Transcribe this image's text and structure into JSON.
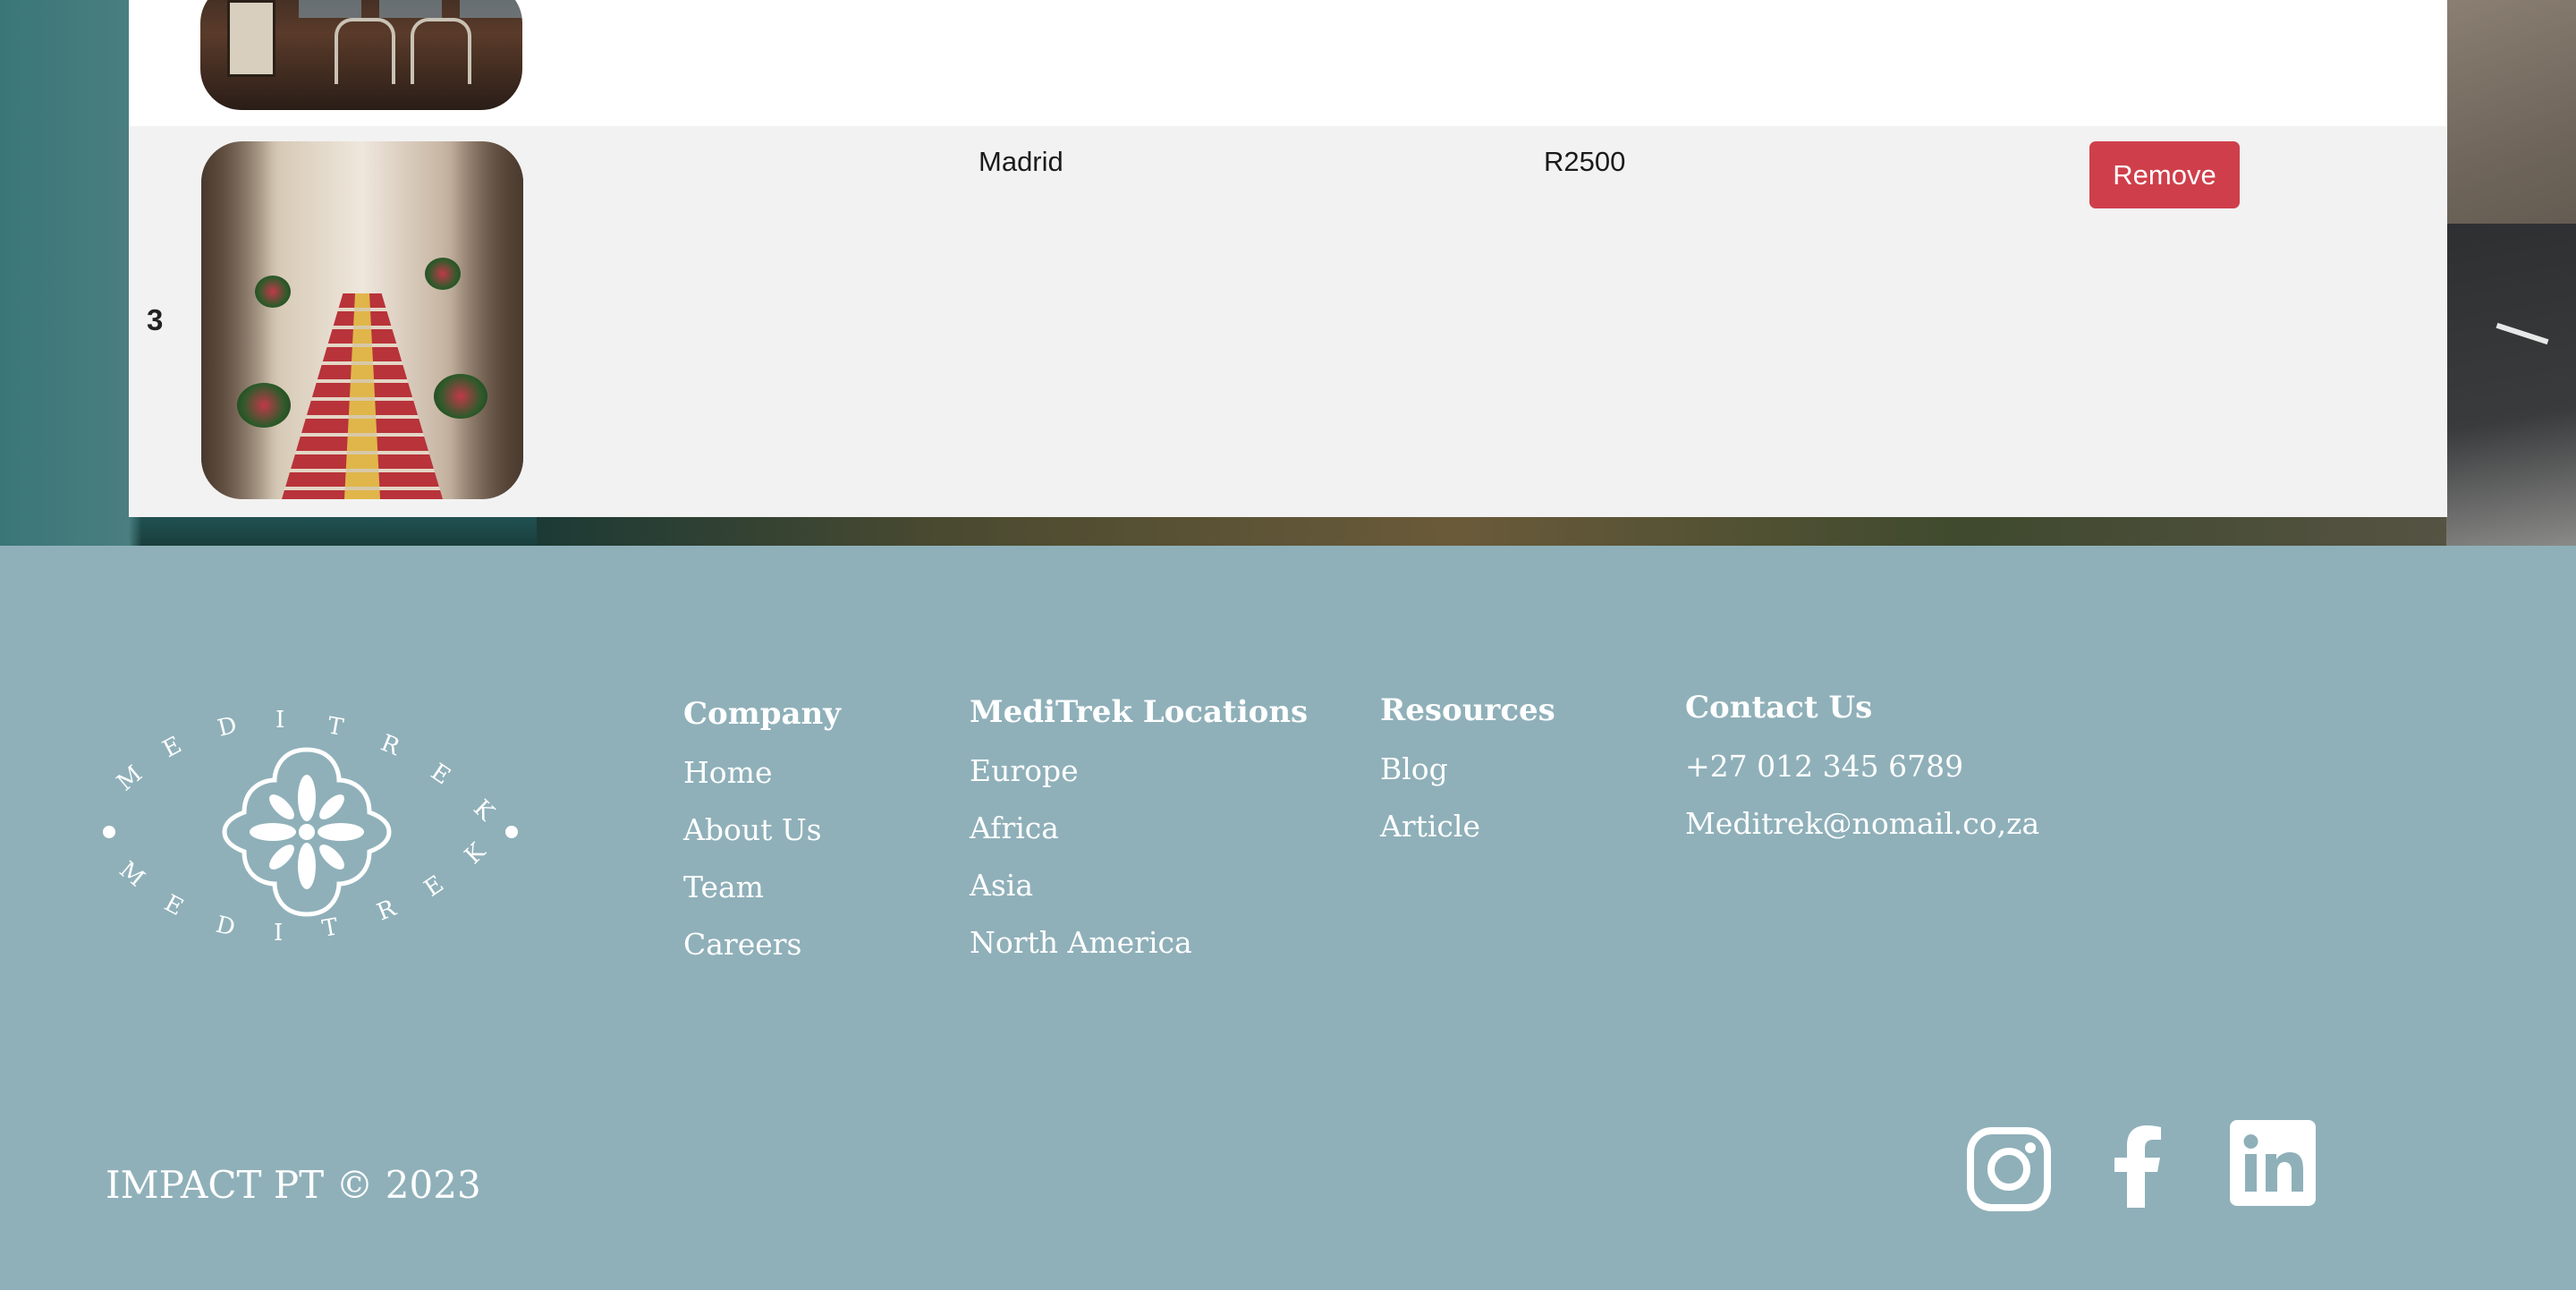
{
  "cart": {
    "rows": [
      {
        "index": "3",
        "destination": "Madrid",
        "price": "R2500",
        "remove_label": "Remove"
      }
    ]
  },
  "footer": {
    "logo_text": "MEDITREK",
    "columns": [
      {
        "title": "Company",
        "links": [
          "Home",
          "About Us",
          "Team",
          "Careers"
        ]
      },
      {
        "title": "MediTrek Locations",
        "links": [
          "Europe",
          "Africa",
          "Asia",
          "North America"
        ]
      },
      {
        "title": "Resources",
        "links": [
          "Blog",
          "Article"
        ]
      },
      {
        "title": "Contact Us",
        "links": [
          "+27 012 345 6789",
          "Meditrek@nomail.co,za"
        ]
      }
    ],
    "copyright": "IMPACT PT © 2023",
    "social": [
      {
        "icon": "instagram-icon"
      },
      {
        "icon": "facebook-icon"
      },
      {
        "icon": "linkedin-icon"
      }
    ]
  },
  "colors": {
    "footer_bg": "#8fb0b9",
    "remove_button": "#cf3f4b",
    "row_alt_bg": "#f2f2f2"
  }
}
